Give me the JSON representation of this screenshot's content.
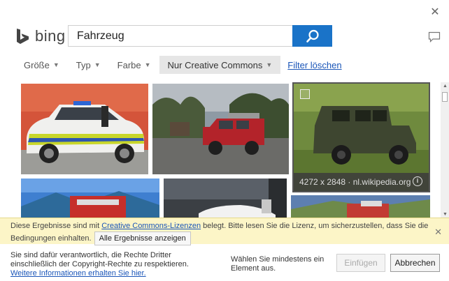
{
  "header": {
    "logo_text": "bing",
    "search_value": "Fahrzeug",
    "close_glyph": "✕"
  },
  "filters": [
    {
      "label": "Größe",
      "has_caret": true
    },
    {
      "label": "Typ",
      "has_caret": true
    },
    {
      "label": "Farbe",
      "has_caret": true
    },
    {
      "label": "Nur Creative Commons",
      "has_caret": true,
      "active": true
    }
  ],
  "filter_clear": "Filter löschen",
  "results": {
    "hovered_tile": {
      "size": "4272 x 2848",
      "source": "nl.wikipedia.org",
      "info_glyph": "i"
    }
  },
  "notice": {
    "text_before": "Diese Ergebnisse sind mit ",
    "link": "Creative Commons-Lizenzen",
    "text_after": " belegt. Bitte lesen Sie die Lizenz, um sicherzustellen, dass Sie die",
    "text_line2": "Bedingungen einhalten.",
    "button": "Alle Ergebnisse anzeigen",
    "close_glyph": "✕"
  },
  "footer": {
    "disclaimer_line1": "Sie sind dafür verantwortlich, die Rechte Dritter",
    "disclaimer_line2": "einschließlich der Copyright-Rechte zu respektieren.",
    "more_info_link": "Weitere Informationen erhalten Sie hier.",
    "selection_hint_line1": "Wählen Sie mindestens ein",
    "selection_hint_line2": "Element aus.",
    "insert_button": "Einfügen",
    "cancel_button": "Abbrechen"
  },
  "colors": {
    "accent_blue": "#1a73c8",
    "link_blue": "#1a55b8",
    "notice_bg": "#fcf5c7"
  }
}
